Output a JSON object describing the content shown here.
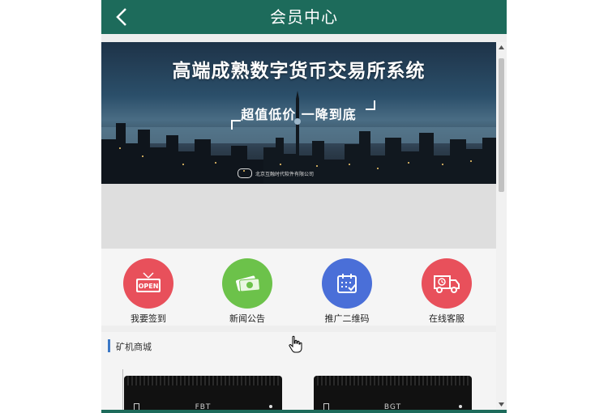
{
  "header": {
    "title": "会员中心",
    "back_icon": "chevron-left-icon"
  },
  "banner": {
    "title": "高端成熟数字货币交易所系统",
    "subtitle": "超值低价  一降到底",
    "company": "北京互融时代软件有限公司"
  },
  "carousel": {
    "active_dot_color": "#e53935",
    "inactive_dot_color": "#333333"
  },
  "quick_actions": [
    {
      "label": "我要签到",
      "icon": "open-sign-icon",
      "color": "#e8505b"
    },
    {
      "label": "新闻公告",
      "icon": "money-icon",
      "color": "#6cc24a"
    },
    {
      "label": "推广二维码",
      "icon": "calendar-icon",
      "color": "#4a6fd8"
    },
    {
      "label": "在线客服",
      "icon": "delivery-truck-icon",
      "color": "#e8505b"
    }
  ],
  "section": {
    "title": "矿机商城"
  },
  "products": [
    {
      "label": "FBT"
    },
    {
      "label": "BGT"
    }
  ],
  "colors": {
    "header_bg": "#1d6b5b",
    "section_accent": "#3c78c6"
  }
}
